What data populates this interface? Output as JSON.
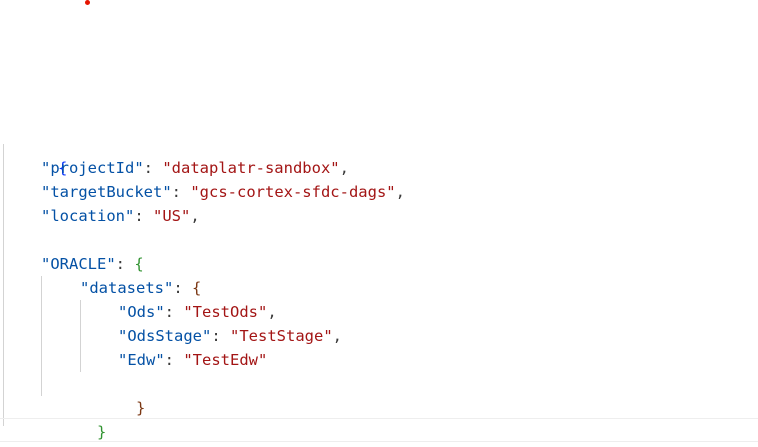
{
  "editor": {
    "lines": [
      {
        "open": "{"
      },
      {
        "key": "\"projectId\"",
        "sep": ": ",
        "value": "\"dataplatr-sandbox\"",
        "end": ","
      },
      {
        "key": "\"targetBucket\"",
        "sep": ": ",
        "value": "\"gcs-cortex-sfdc-dags\"",
        "end": ","
      },
      {
        "key": "\"location\"",
        "sep": ": ",
        "value": "\"US\"",
        "end": ","
      },
      {},
      {
        "key": "\"ORACLE\"",
        "sep": ": ",
        "open": "{"
      },
      {
        "key": "\"datasets\"",
        "sep": ": ",
        "open": "{"
      },
      {
        "key": "\"Ods\"",
        "sep": ": ",
        "value": "\"TestOds\"",
        "end": ","
      },
      {
        "key": "\"OdsStage\"",
        "sep": ": ",
        "value": "\"TestStage\"",
        "end": ","
      },
      {
        "key": "\"Edw\"",
        "sep": ": ",
        "value": "\"TestEdw\""
      },
      {
        "close": "}"
      },
      {
        "close": "}"
      },
      {
        "close": "}"
      }
    ]
  },
  "colors": {
    "key": "#0451a5",
    "string": "#a31515",
    "brace_level1": "#0431fa",
    "brace_level2": "#319331",
    "brace_level3": "#7b3814",
    "error_marker": "#e51400"
  }
}
